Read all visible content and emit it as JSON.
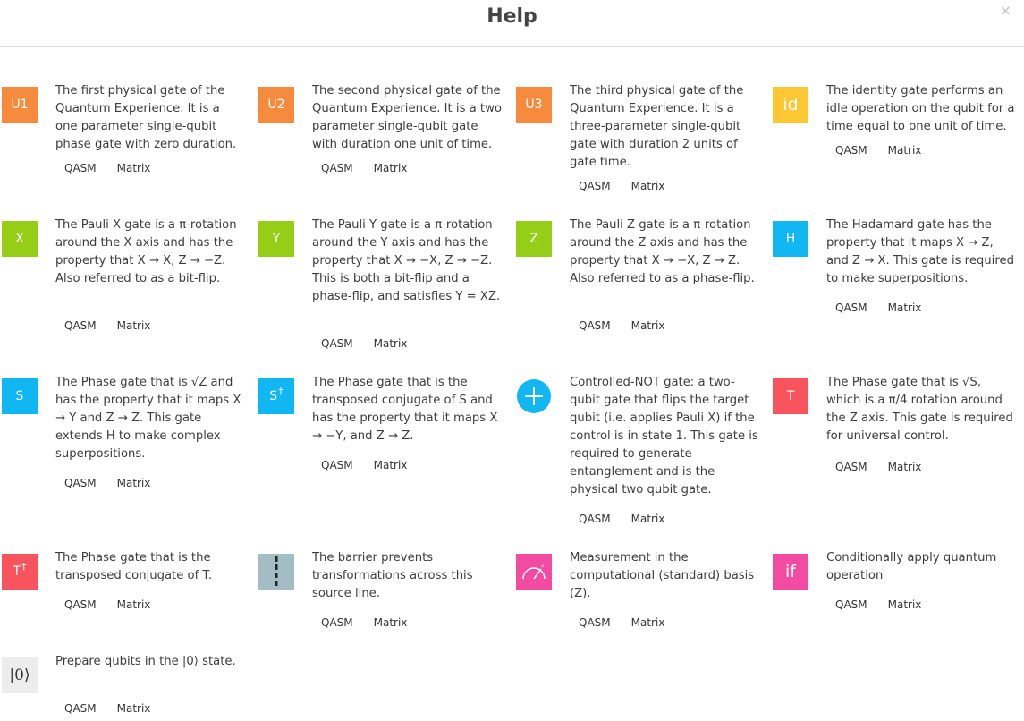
{
  "dialog": {
    "title": "Help",
    "close_icon": "×"
  },
  "link_labels": {
    "qasm": "QASM",
    "matrix": "Matrix"
  },
  "gates": [
    {
      "id": "u1",
      "icon": "U1",
      "color": "#f68a3d",
      "desc": "The first physical gate of the Quantum Experience. It is a one parameter single-qubit phase gate with zero duration."
    },
    {
      "id": "u2",
      "icon": "U2",
      "color": "#f68a3d",
      "desc": "The second physical gate of the Quantum Experience. It is a two parameter single-qubit gate with duration one unit of time."
    },
    {
      "id": "u3",
      "icon": "U3",
      "color": "#f68a3d",
      "desc": "The third physical gate of the Quantum Experience. It is a three-parameter single-qubit gate with duration 2 units of gate time."
    },
    {
      "id": "id",
      "icon": "id",
      "color": "#fcc732",
      "desc": "The identity gate performs an idle operation on the qubit for a time equal to one unit of time."
    },
    {
      "id": "x",
      "icon": "X",
      "color": "#96cd17",
      "desc": "The Pauli X gate is a π-rotation around the X axis and has the property that X → X, Z → −Z. Also referred to as a bit-flip."
    },
    {
      "id": "y",
      "icon": "Y",
      "color": "#96cd17",
      "desc": "The Pauli Y gate is a π-rotation around the Y axis and has the property that X → −X, Z → −Z. This is both a bit-flip and a phase-flip, and satisfies Y = XZ."
    },
    {
      "id": "z",
      "icon": "Z",
      "color": "#96cd17",
      "desc": "The Pauli Z gate is a π-rotation around the Z axis and has the property that X → −X, Z → Z. Also referred to as a phase-flip."
    },
    {
      "id": "h",
      "icon": "H",
      "color": "#10b7f2",
      "desc": "The Hadamard gate has the property that it maps X → Z, and Z → X. This gate is required to make superpositions."
    },
    {
      "id": "s",
      "icon": "S",
      "color": "#10b7f2",
      "desc": "The Phase gate that is √Z and has the property that it maps X → Y and Z → Z. This gate extends H to make complex superpositions."
    },
    {
      "id": "sdg",
      "icon": "S",
      "icon_sup": "†",
      "color": "#10b7f2",
      "desc": "The Phase gate that is the transposed conjugate of S and has the property that it maps X → −Y, and Z → Z."
    },
    {
      "id": "cx",
      "icon": "+",
      "color": "#10b7f2",
      "desc": "Controlled-NOT gate: a two-qubit gate that flips the target qubit (i.e. applies Pauli X) if the control is in state 1. This gate is required to generate entanglement and is the physical two qubit gate."
    },
    {
      "id": "t",
      "icon": "T",
      "color": "#f7545d",
      "desc": "The Phase gate that is √S, which is a π/4 rotation around the Z axis. This gate is required for universal control."
    },
    {
      "id": "tdg",
      "icon": "T",
      "icon_sup": "†",
      "color": "#f7545d",
      "desc": "The Phase gate that is the transposed conjugate of T."
    },
    {
      "id": "barrier",
      "icon": "barrier-icon",
      "color": "#a2bdc3",
      "desc": "The barrier prevents transformations across this source line."
    },
    {
      "id": "measure",
      "icon": "meter-icon",
      "color": "#f34ba2",
      "desc": "Measurement in the computational (standard) basis (Z)."
    },
    {
      "id": "if",
      "icon": "if",
      "color": "#f34ba2",
      "desc": "Conditionally apply quantum operation"
    },
    {
      "id": "reset",
      "icon": "|0⟩",
      "color": "#ededed",
      "desc": "Prepare qubits in the |0⟩ state."
    }
  ]
}
